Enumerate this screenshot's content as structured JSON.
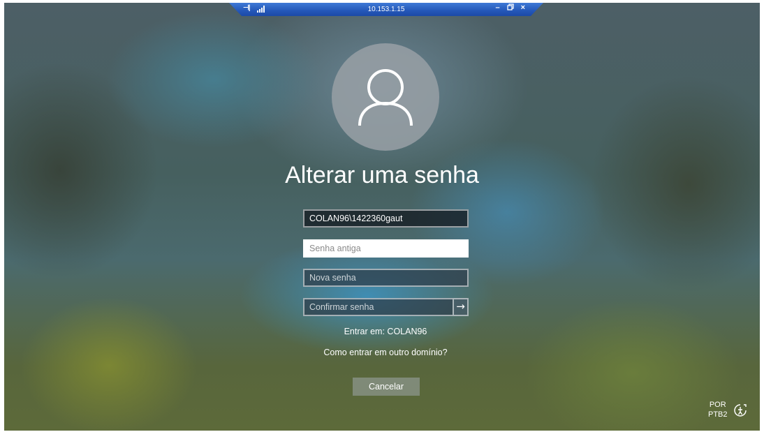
{
  "rdp_bar": {
    "host": "10.153.1.15",
    "pin_icon": "pin-icon",
    "signal_icon": "connection-signal-icon",
    "minimize_glyph": "–",
    "restore_glyph": "ᗟ",
    "close_glyph": "×"
  },
  "login": {
    "avatar_icon": "user-avatar-icon",
    "title": "Alterar uma senha",
    "username_value": "COLAN96\\1422360gaut",
    "old_password_placeholder": "Senha antiga",
    "new_password_placeholder": "Nova senha",
    "confirm_password_placeholder": "Confirmar senha",
    "submit_glyph": "→",
    "sign_in_to": "Entrar em: COLAN96",
    "other_domain_link": "Como entrar em outro domínio?",
    "cancel_label": "Cancelar"
  },
  "system_tray": {
    "lang_line1": "POR",
    "lang_line2": "PTB2",
    "accessibility_icon": "ease-of-access-icon"
  },
  "colors": {
    "rdp_bar": "#2457b8",
    "text": "#ffffff",
    "active_field": "#ffffff"
  }
}
